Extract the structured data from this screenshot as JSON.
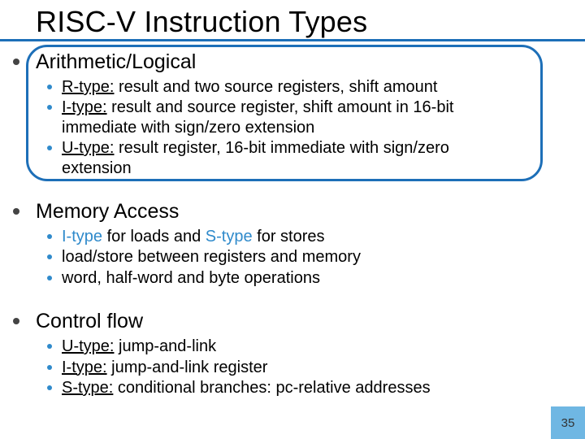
{
  "title": "RISC-V Instruction Types",
  "page_number": "35",
  "sections": [
    {
      "heading": "Arithmetic/Logical",
      "items": [
        {
          "lead": "R-type:",
          "rest": " result and two source registers, shift amount"
        },
        {
          "lead": "I-type:",
          "rest": " result and source register, shift amount in 16-bit immediate with sign/zero extension"
        },
        {
          "lead": "U-type:",
          "rest": " result register, 16-bit immediate with sign/zero extension"
        }
      ],
      "circled": true
    },
    {
      "heading": "Memory Access",
      "items": [
        {
          "accent_a": "I-type",
          "mid": " for loads and ",
          "accent_b": "S-type",
          "end": " for stores"
        },
        {
          "plain": "load/store between registers and memory"
        },
        {
          "plain": "word, half-word and byte operations"
        }
      ]
    },
    {
      "heading": "Control flow",
      "items": [
        {
          "lead": "U-type:",
          "rest": " jump-and-link"
        },
        {
          "lead": "I-type:",
          "rest": " jump-and-link register"
        },
        {
          "lead": "S-type:",
          "rest": " conditional branches: pc-relative addresses"
        }
      ]
    }
  ]
}
